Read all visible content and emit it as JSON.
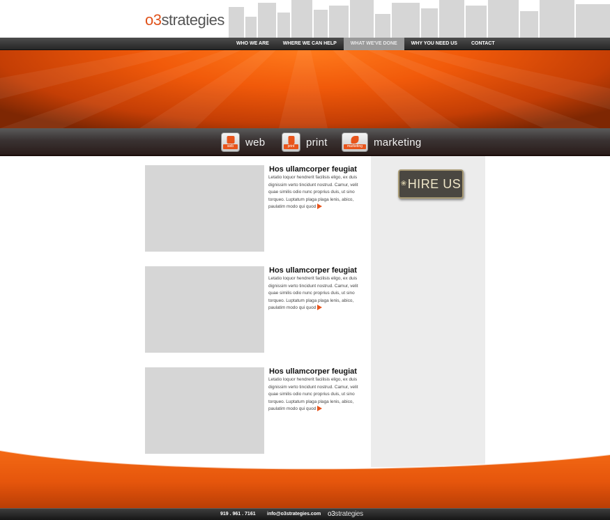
{
  "brand": {
    "logo_prefix": "o3",
    "logo_suffix": "strategies",
    "accent_color": "#e8541b"
  },
  "nav": {
    "items": [
      {
        "label": "WHO WE ARE"
      },
      {
        "label": "WHERE WE CAN HELP"
      },
      {
        "label": "WHAT WE'VE DONE",
        "active": true
      },
      {
        "label": "WHY YOU NEED US"
      },
      {
        "label": "CONTACT"
      }
    ]
  },
  "services": [
    {
      "label": "web",
      "icon_tag": "web",
      "icon": "monitor-icon"
    },
    {
      "label": "print",
      "icon_tag": "print",
      "icon": "document-icon"
    },
    {
      "label": "marketing",
      "icon_tag": "marketing",
      "icon": "megaphone-icon"
    }
  ],
  "sidebar": {
    "hire_label": "HIRE US",
    "hire_icon": "❀"
  },
  "articles": [
    {
      "title": "Hos ullamcorper feugiat",
      "body": "Letatio loquor hendrerit facilisis eligo, ex duis dignissim verto tincidunt nostrud. Camur, velit quae similis odio nunc proprius duis, ut sino torqueo. Luptatum plaga plaga lenis, abico, paulatim modo qui quod"
    },
    {
      "title": "Hos ullamcorper feugiat",
      "body": "Letatio loquor hendrerit facilisis eligo, ex duis dignissim verto tincidunt nostrud. Camur, velit quae similis odio nunc proprius duis, ut sino torqueo. Luptatum plaga plaga lenis, abico, paulatim modo qui quod"
    },
    {
      "title": "Hos ullamcorper feugiat",
      "body": "Letatio loquor hendrerit facilisis eligo, ex duis dignissim verto tincidunt nostrud. Camur, velit quae similis odio nunc proprius duis, ut sino torqueo. Luptatum plaga plaga lenis, abico, paulatim modo qui quod"
    }
  ],
  "footer": {
    "phone": "919 . 961 . 7161",
    "email": "info@o3strategies.com",
    "logo_prefix": "o3",
    "logo_suffix": "strategies"
  }
}
